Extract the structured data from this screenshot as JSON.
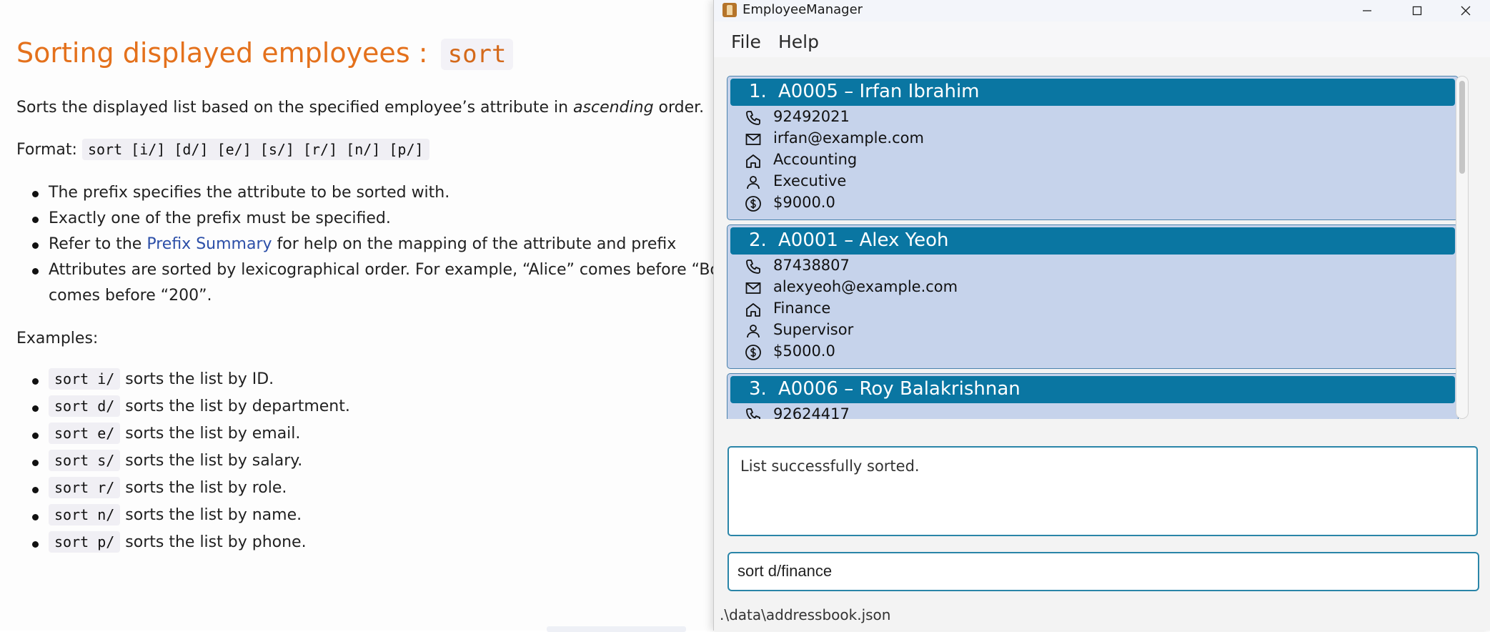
{
  "doc": {
    "title": "Sorting displayed employees :",
    "title_code": "sort",
    "intro_before": "Sorts the displayed list based on the specified employee’s attribute in ",
    "intro_em": "ascending",
    "intro_after": " order.",
    "format_label": "Format:",
    "format_code": "sort [i/] [d/] [e/] [s/] [r/] [n/] [p/]",
    "bullets": [
      "The prefix specifies the attribute to be sorted with.",
      "Exactly one of the prefix must be specified.",
      "for help on the mapping of the attribute and prefix",
      "Attributes are sorted by lexicographical order. For example, “Alice” comes before “Bob”,",
      "comes before “200”."
    ],
    "bullet3_prefix": "Refer to the",
    "bullet3_link": "Prefix Summary",
    "examples_label": "Examples:",
    "examples": [
      {
        "code": "sort i/",
        "desc": "sorts the list by ID."
      },
      {
        "code": "sort d/",
        "desc": "sorts the list by department."
      },
      {
        "code": "sort e/",
        "desc": "sorts the list by email."
      },
      {
        "code": "sort s/",
        "desc": "sorts the list by salary."
      },
      {
        "code": "sort r/",
        "desc": "sorts the list by role."
      },
      {
        "code": "sort n/",
        "desc": "sorts the list by name."
      },
      {
        "code": "sort p/",
        "desc": "sorts the list by phone."
      }
    ]
  },
  "window": {
    "title": "EmployeeManager",
    "menu": {
      "file": "File",
      "help": "Help"
    }
  },
  "employees": [
    {
      "index": "1.",
      "header": "A0005 – Irfan Ibrahim",
      "phone": "92492021",
      "email": "irfan@example.com",
      "department": "Accounting",
      "role": "Executive",
      "salary": "$9000.0"
    },
    {
      "index": "2.",
      "header": "A0001 – Alex Yeoh",
      "phone": "87438807",
      "email": "alexyeoh@example.com",
      "department": "Finance",
      "role": "Supervisor",
      "salary": "$5000.0"
    },
    {
      "index": "3.",
      "header": "A0006 – Roy Balakrishnan",
      "phone": "92624417"
    }
  ],
  "result": {
    "text": "List successfully sorted."
  },
  "command": {
    "value": "sort d/finance"
  },
  "status": {
    "path": ".\\data\\addressbook.json"
  },
  "colors": {
    "accent": "#0a76a2",
    "card_bg": "#c6d3eb",
    "title": "#e4711c",
    "link": "#2c4fa8"
  },
  "icons": [
    "phone-icon",
    "mail-icon",
    "home-icon",
    "person-icon",
    "dollar-icon"
  ]
}
